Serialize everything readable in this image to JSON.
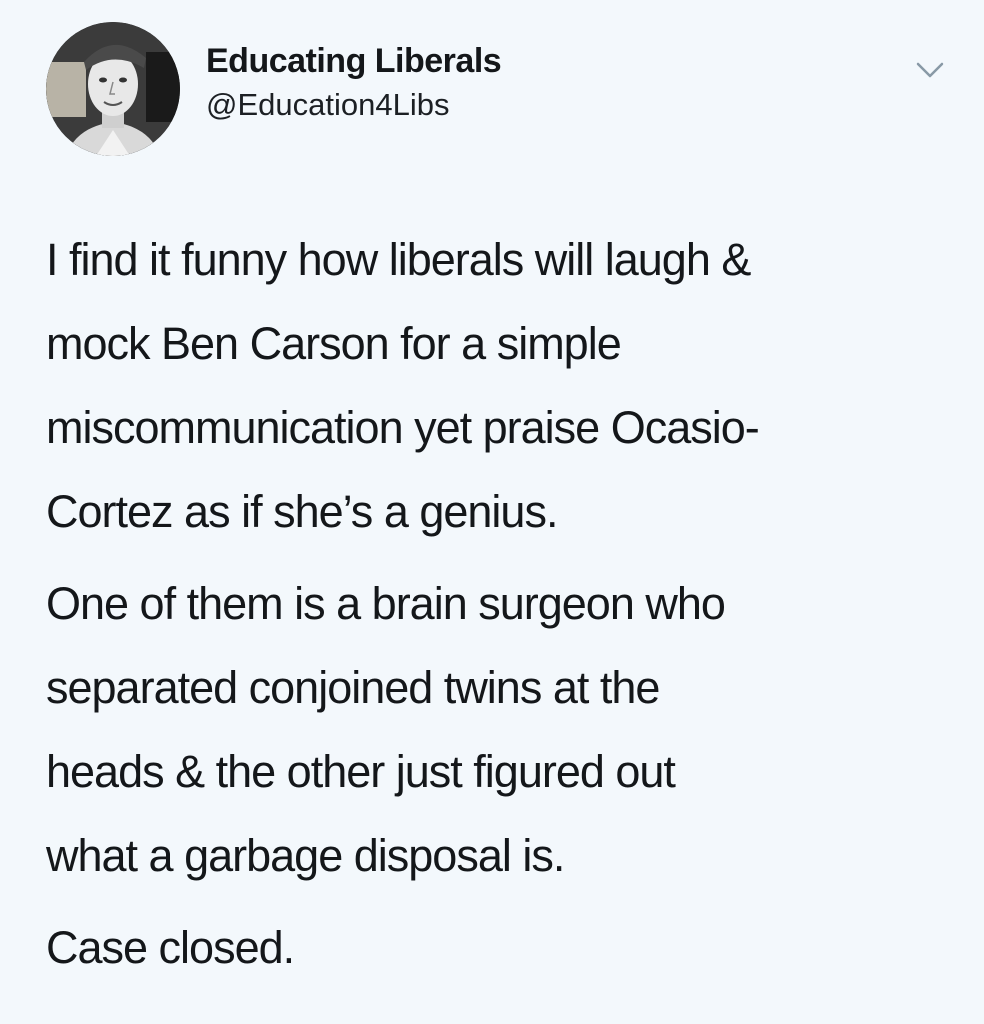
{
  "author": {
    "display_name": "Educating Liberals",
    "handle": "@Education4Libs",
    "avatar_icon": "profile-photo"
  },
  "menu": {
    "icon": "chevron-down-icon"
  },
  "tweet": {
    "paragraphs": [
      {
        "lines": [
          "I find it funny how liberals will laugh &",
          "mock Ben Carson for a simple",
          "miscommunication yet praise Ocasio-",
          "Cortez as if she’s a genius."
        ]
      },
      {
        "lines": [
          "One of them is a brain surgeon who",
          "separated conjoined twins at the",
          "heads & the other just figured out",
          "what a garbage disposal is."
        ]
      },
      {
        "lines": [
          "Case closed."
        ]
      }
    ]
  },
  "colors": {
    "background": "#f3f8fc",
    "text": "#14171a",
    "chevron": "#8899a6"
  }
}
